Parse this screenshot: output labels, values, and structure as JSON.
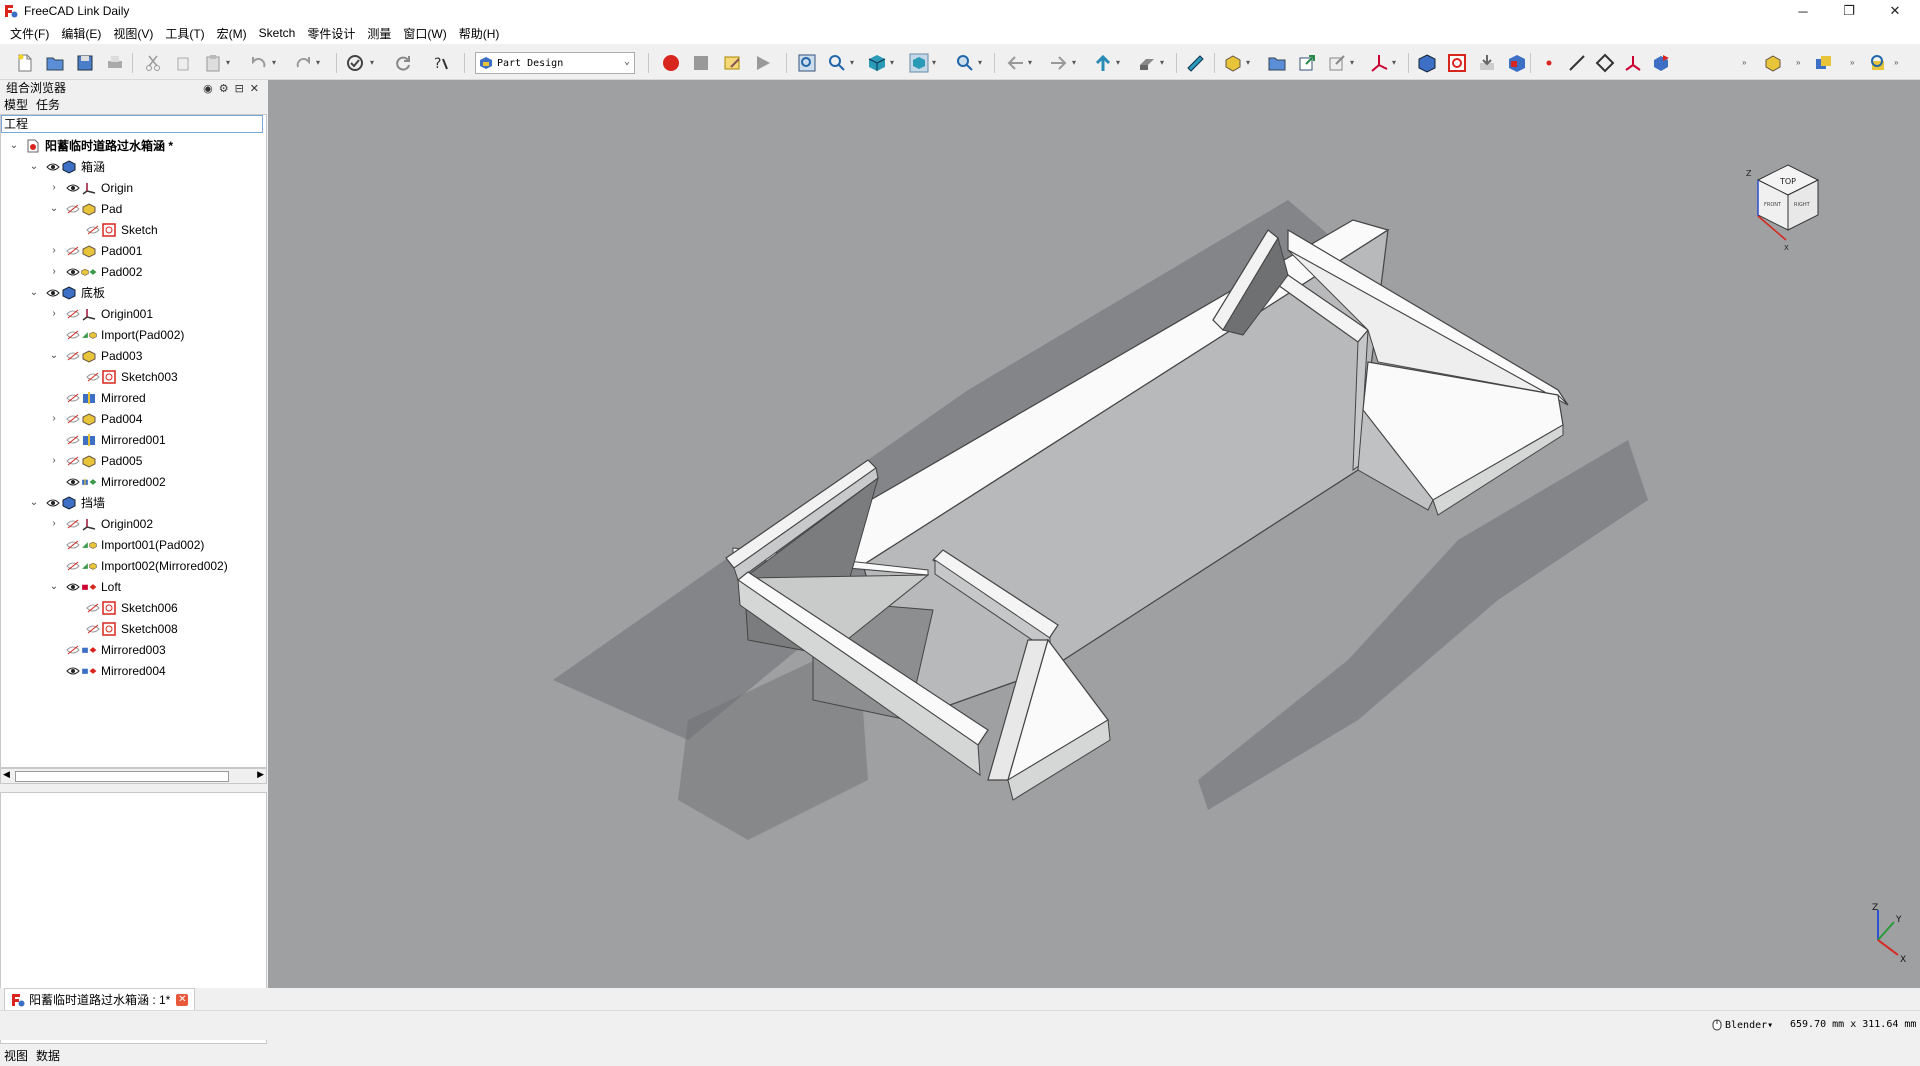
{
  "window": {
    "title": "FreeCAD Link Daily",
    "minimize": "─",
    "restore": "❐",
    "close": "✕"
  },
  "menu": [
    "文件(F)",
    "编辑(E)",
    "视图(V)",
    "工具(T)",
    "宏(M)",
    "Sketch",
    "零件设计",
    "测量",
    "窗口(W)",
    "帮助(H)"
  ],
  "toolbar": {
    "workbench": "Part Design"
  },
  "combo_view": {
    "title": "组合浏览器",
    "tabs": [
      "模型",
      "任务"
    ],
    "tree_header": "工程",
    "tree": [
      {
        "label": "阳蓄临时道路过水箱涵 *",
        "bold": true
      },
      {
        "label": "箱涵"
      },
      {
        "label": "Origin"
      },
      {
        "label": "Pad"
      },
      {
        "label": "Sketch"
      },
      {
        "label": "Pad001"
      },
      {
        "label": "Pad002"
      },
      {
        "label": "底板"
      },
      {
        "label": "Origin001"
      },
      {
        "label": "Import(Pad002)"
      },
      {
        "label": "Pad003"
      },
      {
        "label": "Sketch003"
      },
      {
        "label": "Mirrored"
      },
      {
        "label": "Pad004"
      },
      {
        "label": "Mirrored001"
      },
      {
        "label": "Pad005"
      },
      {
        "label": "Mirrored002"
      },
      {
        "label": "挡墙"
      },
      {
        "label": "Origin002"
      },
      {
        "label": "Import001(Pad002)"
      },
      {
        "label": "Import002(Mirrored002)"
      },
      {
        "label": "Loft"
      },
      {
        "label": "Sketch006"
      },
      {
        "label": "Sketch008"
      },
      {
        "label": "Mirrored003"
      },
      {
        "label": "Mirrored004"
      }
    ],
    "bottom_tabs": [
      "视图",
      "数据"
    ]
  },
  "navcube": {
    "face": "TOP",
    "front": "FRONT",
    "right": "RIGHT",
    "axis_z": "Z",
    "axis_x": "X"
  },
  "axis_triad": {
    "z": "Z",
    "y": "Y",
    "x": "X"
  },
  "document_tab": {
    "label": "阳蓄临时道路过水箱涵 : 1*"
  },
  "status": {
    "navigation": "Blender",
    "dimensions": "659.70 mm x 311.64 mm"
  },
  "colors": {
    "viewport_bg": "#9ea0a2",
    "accent": "#d8261e"
  }
}
